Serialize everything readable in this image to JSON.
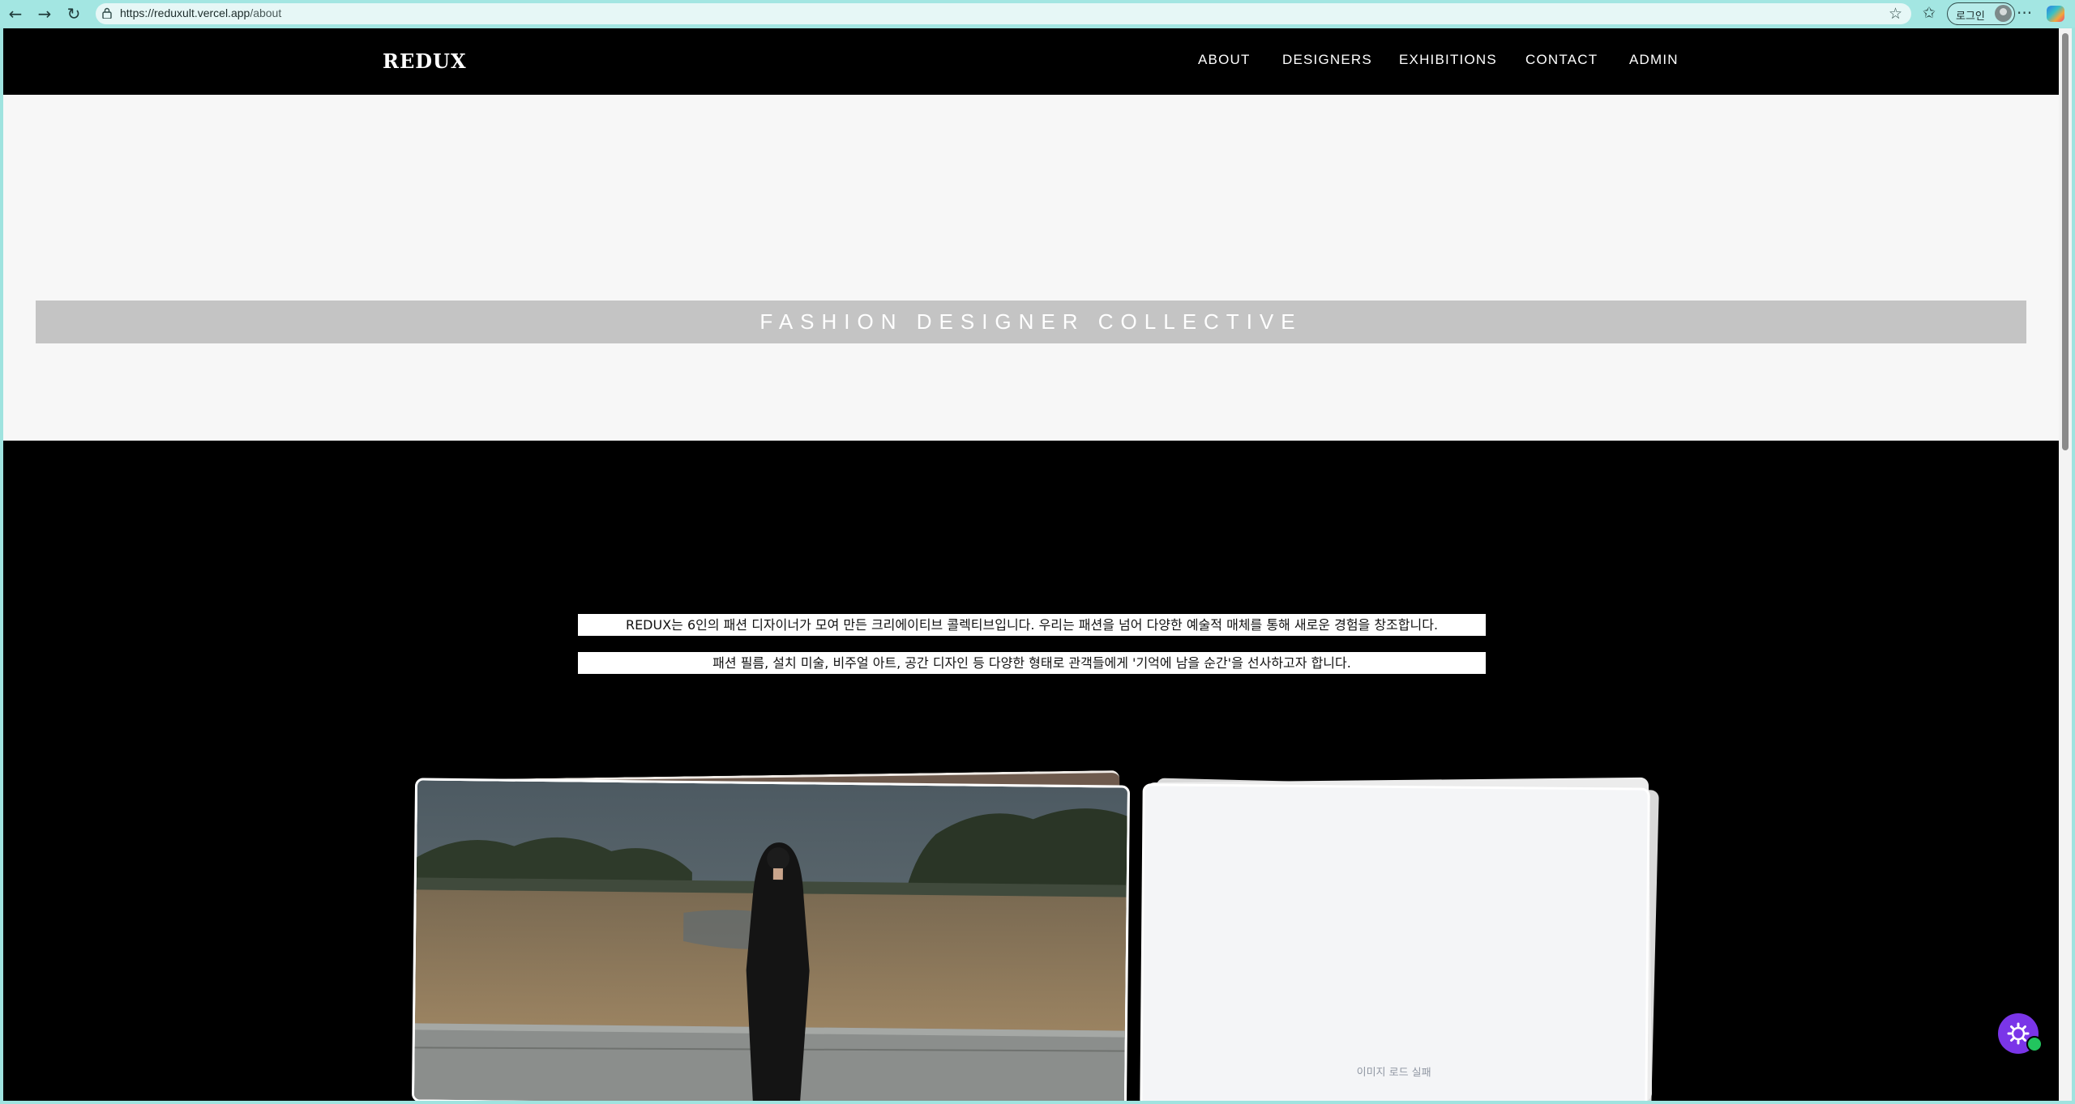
{
  "browser": {
    "url_host": "https://reduxult.vercel.app",
    "url_path": "/about",
    "login_label": "로그인"
  },
  "site": {
    "logo": "REDUX",
    "nav": [
      {
        "label": "ABOUT"
      },
      {
        "label": "DESIGNERS"
      },
      {
        "label": "EXHIBITIONS"
      },
      {
        "label": "CONTACT"
      },
      {
        "label": "ADMIN"
      }
    ]
  },
  "hero": {
    "tagline": "FASHION DESIGNER COLLECTIVE"
  },
  "intro": {
    "line1": "REDUX는 6인의 패션 디자이너가 모여 만든 크리에이티브 콜렉티브입니다. 우리는 패션을 넘어 다양한 예술적 매체를 통해 새로운 경험을 창조합니다.",
    "line2": "패션 필름, 설치 미술, 비주얼 아트, 공간 디자인 등 다양한 형태로 관객들에게 '기억에 남을 순간'을 선사하고자 합니다."
  },
  "gallery": {
    "image_error": "이미지 로드 실패"
  },
  "icons": {
    "back": "arrow-left-icon",
    "forward": "arrow-right-icon",
    "reload": "reload-icon",
    "lock": "lock-icon",
    "favorite": "star-icon",
    "favorites": "favorites-icon",
    "more": "more-icon",
    "copilot": "copilot-icon",
    "settings": "gear-icon"
  },
  "colors": {
    "chrome": "#a3e6e2",
    "header": "#000000",
    "hero_bg": "#f7f7f7",
    "tagline_band": "#c4c4c4",
    "fab": "#7a35e8"
  }
}
